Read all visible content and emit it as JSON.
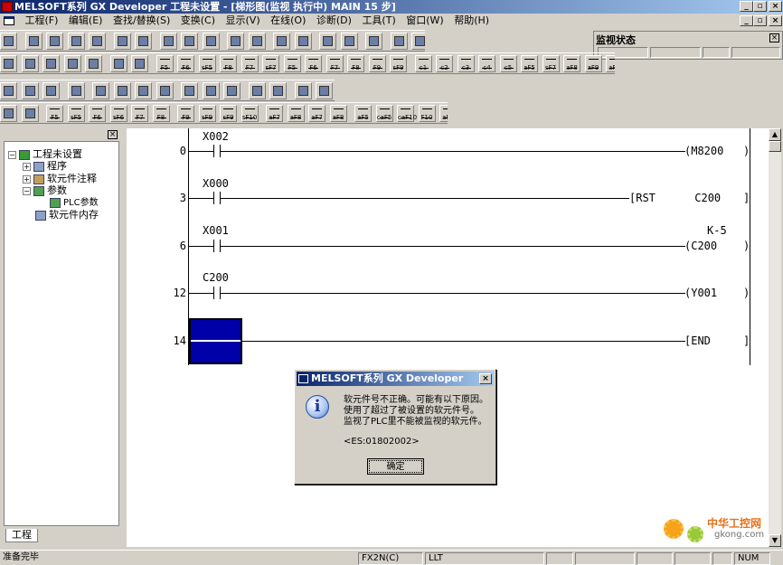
{
  "window": {
    "title": "MELSOFT系列 GX Developer 工程未设置 - [梯形图(监视 执行中)   MAIN   15 步]",
    "min": "_",
    "restore": "▫",
    "close": "×"
  },
  "menu": [
    "工程(F)",
    "编辑(E)",
    "查找/替换(S)",
    "变换(C)",
    "显示(V)",
    "在线(O)",
    "诊断(D)",
    "工具(T)",
    "窗口(W)",
    "帮助(H)"
  ],
  "monitor_panel": {
    "title": "监视状态",
    "close": "×"
  },
  "toolbar_fkeys": [
    "F5",
    "sF5",
    "F6",
    "sF6",
    "F7",
    "sF7",
    "F8",
    "F9",
    "sF9",
    "F10",
    "sF10",
    "aF7",
    "aF8",
    "aF5",
    "caF5",
    "caF10",
    "F10",
    "aF9"
  ],
  "toolbar_fkeys2": [
    "F5",
    "F6",
    "F8",
    "sF8",
    "F5",
    "F6",
    "F7",
    "F8",
    "F9",
    "sF9",
    "c1",
    "c2",
    "c3",
    "c4",
    "c5",
    "aF5",
    "sF7",
    "aF8",
    "aF9",
    "aF0",
    "cF9"
  ],
  "tree": {
    "root": "工程未设置",
    "items": [
      "程序",
      "软元件注释",
      "参数",
      "PLC参数",
      "软元件内存"
    ],
    "tab": "工程",
    "close": "×"
  },
  "ladder": {
    "rungs": [
      {
        "step": "0",
        "contact": "X002",
        "coil": "(M8200",
        "end": ")"
      },
      {
        "step": "3",
        "contact": "X000",
        "coil": "[RST      C200",
        "end": "]"
      },
      {
        "step": "6",
        "contact": "X001",
        "coil": "(C200",
        "end": ")",
        "extra": "K-5"
      },
      {
        "step": "12",
        "contact": "C200",
        "coil": "(Y001",
        "end": ")"
      },
      {
        "step": "14",
        "contact": "",
        "coil": "[END",
        "end": "]"
      }
    ]
  },
  "dialog": {
    "title": "MELSOFT系列 GX Developer",
    "icon": "i",
    "lines": [
      "软元件号不正确。可能有以下原因。",
      "使用了超过了被设置的软元件号。",
      "监视了PLC里不能被监视的软元件。"
    ],
    "code": "<ES:01802002>",
    "ok": "确定",
    "close": "×"
  },
  "status": {
    "ready": "准备完毕",
    "plc": "FX2N(C)",
    "mode": "LLT",
    "num": "NUM"
  },
  "watermark": {
    "name": "中华工控网",
    "url": "gkong.com"
  },
  "scroll": {
    "up": "▲",
    "down": "▼"
  }
}
